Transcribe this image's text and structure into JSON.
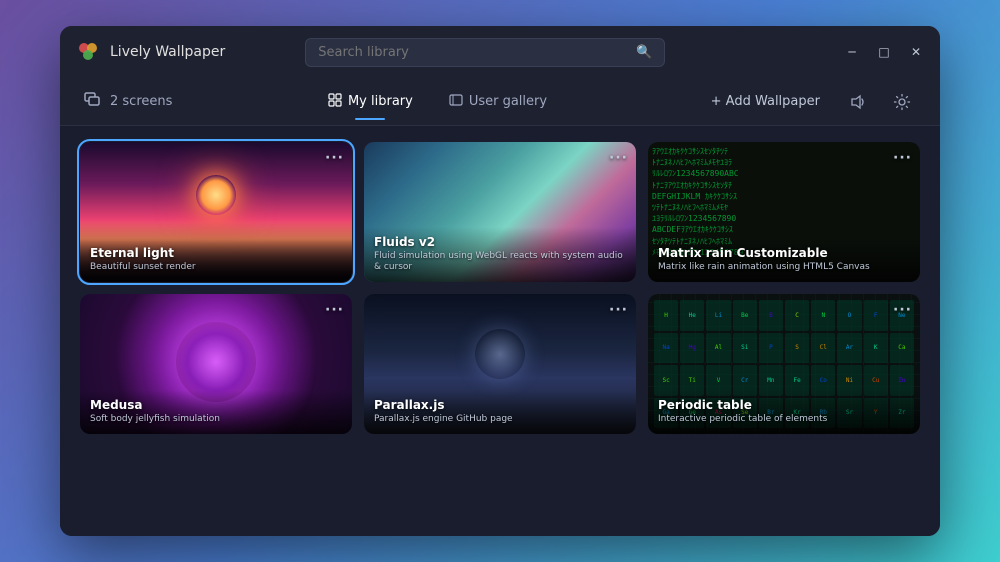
{
  "app": {
    "title": "Lively Wallpaper",
    "logo_colors": [
      "#e05050",
      "#e0a030",
      "#50b050"
    ]
  },
  "titlebar": {
    "search_placeholder": "Search library",
    "minimize_label": "─",
    "maximize_label": "□",
    "close_label": "✕"
  },
  "navbar": {
    "screens_icon": "⊞",
    "screens_label": "2 screens",
    "tabs": [
      {
        "id": "my-library",
        "icon": "⊞",
        "label": "My library",
        "active": true
      },
      {
        "id": "user-gallery",
        "icon": "◻",
        "label": "User gallery",
        "active": false
      }
    ],
    "add_wallpaper": "+ Add Wallpaper",
    "volume_icon": "🔊",
    "settings_icon": "⚙"
  },
  "wallpapers": [
    {
      "id": "eternal-light",
      "title": "Eternal light",
      "description": "Beautiful sunset render",
      "selected": true,
      "row": 1
    },
    {
      "id": "fluids-v2",
      "title": "Fluids v2",
      "description": "Fluid simulation using WebGL reacts with system audio & cursor",
      "selected": false,
      "row": 1
    },
    {
      "id": "matrix-rain",
      "title": "Matrix rain Customizable",
      "description": "Matrix like rain animation using HTML5 Canvas",
      "selected": false,
      "row": 1
    },
    {
      "id": "medusa",
      "title": "Medusa",
      "description": "Soft body jellyfish simulation",
      "selected": false,
      "row": 2
    },
    {
      "id": "parallax",
      "title": "Parallax.js",
      "description": "Parallax.js engine GitHub page",
      "selected": false,
      "row": 2
    },
    {
      "id": "periodic-table",
      "title": "Periodic table",
      "description": "Interactive periodic table of elements",
      "selected": false,
      "row": 2
    }
  ],
  "periodic_elements": [
    "H",
    "He",
    "Li",
    "Be",
    "B",
    "C",
    "N",
    "O",
    "F",
    "Ne",
    "Na",
    "Mg",
    "Al",
    "Si",
    "P",
    "S",
    "Cl",
    "Ar",
    "K",
    "Ca",
    "Sc",
    "Ti",
    "V",
    "Cr",
    "Mn",
    "Fe",
    "Co",
    "Ni",
    "Cu",
    "Zn",
    "Ga",
    "Ge",
    "As",
    "Se",
    "Br",
    "Kr",
    "Rb",
    "Sr",
    "Y",
    "Zr"
  ],
  "matrix_chars": "ｦｱｳｴｵｶｷｸｹｺｻｼｽｾｿﾀﾁﾂﾃﾄﾅﾆﾇﾈﾉﾊﾋﾌﾍﾎﾏﾐﾑﾒﾓﾔﾕﾖﾗﾘﾙﾚﾛﾜﾝ1234567890ABCDEFGH"
}
